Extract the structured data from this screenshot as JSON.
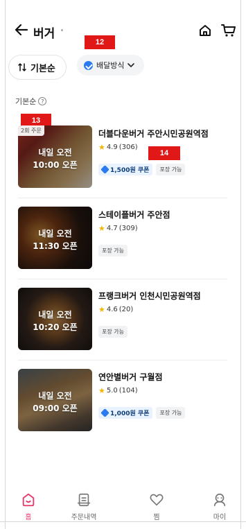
{
  "header": {
    "title": "버거",
    "back_icon": "arrow-left-icon",
    "home_icon": "home-icon",
    "cart_icon": "cart-icon"
  },
  "annotations": {
    "badge_12": "12",
    "badge_13": "13",
    "badge_14": "14"
  },
  "filters": {
    "sort_chip": "기본순",
    "delivery_chip": "배달방식",
    "sort_label": "기본순",
    "help_glyph": "?"
  },
  "stores": [
    {
      "name": "더블다운버거 주안시민공원역점",
      "rating": "4.9",
      "reviews": "(306)",
      "open_line1": "내일 오전",
      "open_line2": "10:00 오픈",
      "order_tag": "2회 주문",
      "coupon": "1,500원 쿠폰",
      "packaging": "포장 가능"
    },
    {
      "name": "스테이플버거 주안점",
      "rating": "4.7",
      "reviews": "(309)",
      "open_line1": "내일 오전",
      "open_line2": "11:30 오픈",
      "packaging": "포장 가능"
    },
    {
      "name": "프랭크버거 인천시민공원역점",
      "rating": "4.6",
      "reviews": "(20)",
      "open_line1": "내일 오전",
      "open_line2": "10:20 오픈",
      "packaging": "포장 가능"
    },
    {
      "name": "연안별버거 구월점",
      "rating": "5.0",
      "reviews": "(104)",
      "open_line1": "내일 오전",
      "open_line2": "09:00 오픈",
      "coupon": "1,000원 쿠폰",
      "packaging": "포장 가능"
    }
  ],
  "bottom_nav": [
    {
      "label": "홈",
      "icon": "home-tab-icon",
      "active": true
    },
    {
      "label": "주문내역",
      "icon": "receipt-icon",
      "active": false
    },
    {
      "label": "찜",
      "icon": "heart-icon",
      "active": false
    },
    {
      "label": "마이",
      "icon": "profile-icon",
      "active": false
    }
  ],
  "colors": {
    "accent": "#e8386a",
    "badge": "#e01818",
    "coupon_bg": "#e8f3ff",
    "star": "#f5b400"
  }
}
